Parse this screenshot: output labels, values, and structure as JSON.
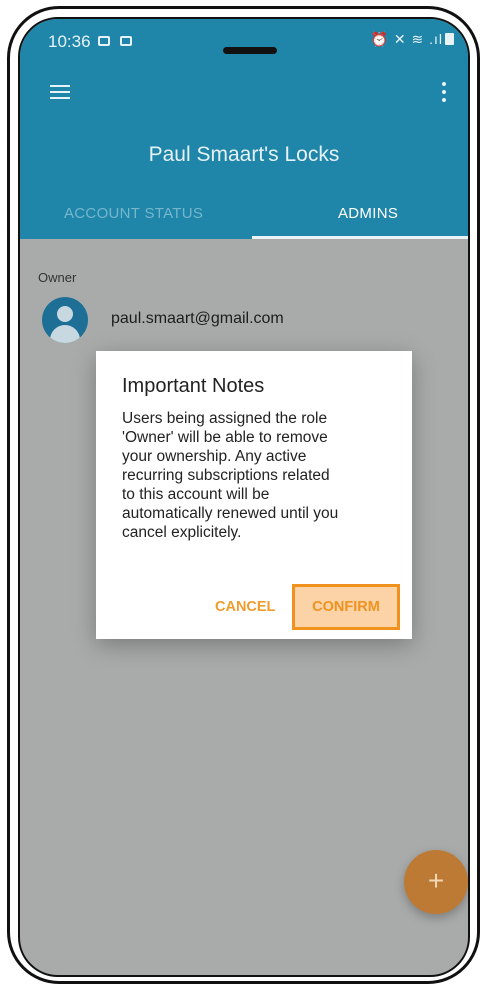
{
  "status_bar": {
    "time": "10:36",
    "right_icons": "⏰ ✕ ≋ .ıl"
  },
  "app_bar": {
    "title": "Paul Smaart's Locks",
    "tabs": [
      {
        "label": "ACCOUNT STATUS",
        "selected": false
      },
      {
        "label": "ADMINS",
        "selected": true
      }
    ]
  },
  "owner_section": {
    "label": "Owner",
    "email": "paul.smaart@gmail.com"
  },
  "dialog": {
    "title": "Important Notes",
    "lines": [
      "Users being assigned the role",
      "'Owner' will be able to remove",
      "your ownership. Any active",
      "recurring subscriptions related",
      "to this account will be",
      "automatically renewed until you",
      "cancel explicitely."
    ],
    "cancel_label": "CANCEL",
    "confirm_label": "CONFIRM"
  },
  "fab": {
    "label": "+"
  },
  "colors": {
    "primary": "#1f86a9",
    "accent": "#ee9d2d",
    "scrim": "#a9abab"
  }
}
